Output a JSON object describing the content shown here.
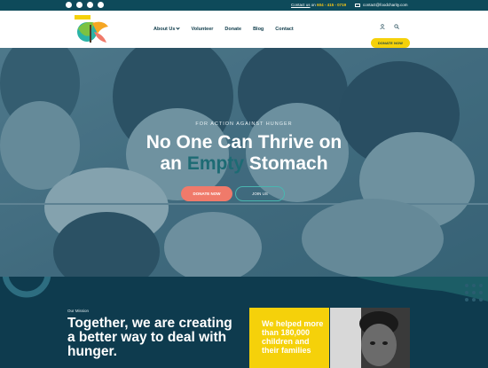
{
  "topbar": {
    "social_icons": [
      "facebook-icon",
      "youtube-icon",
      "twitter-icon",
      "instagram-icon"
    ],
    "contact_link": "Contact us",
    "contact_connector": "on",
    "phone": "604 - 415 - 0719",
    "email": "contact@foodcharity.com"
  },
  "header": {
    "logo_alt": "Food Charity logo",
    "nav": {
      "about": "About Us",
      "volunteer": "Volunteer",
      "donate": "Donate",
      "blog": "Blog",
      "contact": "Contact"
    },
    "cta": "DONATE NOW",
    "icons": [
      "user-icon",
      "search-icon"
    ]
  },
  "hero": {
    "eyebrow": "FOR ACTION AGAINST HUNGER",
    "headline_line1": "No One Can Thrive on",
    "headline_pre": "an ",
    "headline_accent": "Empty",
    "headline_post": " Stomach",
    "primary_button": "DONATE NOW",
    "secondary_button": "JOIN US"
  },
  "mission": {
    "eyebrow": "Our Mission",
    "title": "Together, we are creating a better way to deal with hunger.",
    "card_text": "We helped more than 180,000 children and their families"
  },
  "colors": {
    "topbar": "#0e4a5a",
    "brand_yellow": "#f5d10a",
    "coral": "#f07a6a",
    "teal": "#49b6b0",
    "navy": "#0e3b4e"
  }
}
